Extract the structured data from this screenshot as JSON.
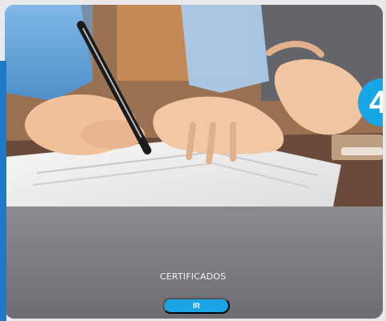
{
  "card": {
    "number": "4",
    "title": "CERTIFICADOS",
    "button_label": "IR"
  },
  "colors": {
    "accent": "#18A4E6",
    "left_accent": "#1E78C8"
  },
  "icons": {
    "photo": "document-signing-photo"
  }
}
